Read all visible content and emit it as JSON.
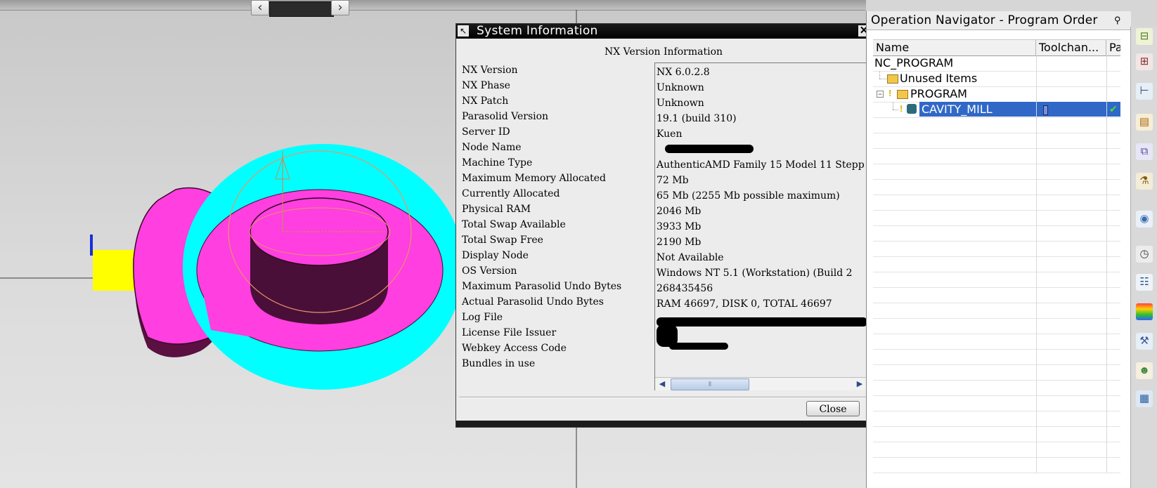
{
  "dialog": {
    "title": "System Information",
    "heading": "NX Version Information",
    "close_label": "Close",
    "rows": [
      {
        "label": "NX Version",
        "value": "NX 6.0.2.8"
      },
      {
        "label": "NX Phase",
        "value": "Unknown"
      },
      {
        "label": "NX Patch",
        "value": "Unknown"
      },
      {
        "label": "Parasolid Version",
        "value": "19.1 (build 310)"
      },
      {
        "label": "Server ID",
        "value": "Kuen"
      },
      {
        "label": "Node Name",
        "value": ""
      },
      {
        "label": "Machine Type",
        "value": "AuthenticAMD Family 15 Model 11 Stepp"
      },
      {
        "label": "Maximum Memory Allocated",
        "value": "72 Mb"
      },
      {
        "label": "Currently Allocated",
        "value": "65 Mb (2255 Mb possible maximum)"
      },
      {
        "label": "Physical RAM",
        "value": "2046 Mb"
      },
      {
        "label": "Total Swap Available",
        "value": "3933 Mb"
      },
      {
        "label": "Total Swap Free",
        "value": "2190 Mb"
      },
      {
        "label": "Display Node",
        "value": "Not Available"
      },
      {
        "label": "OS Version",
        "value": "Windows NT 5.1 (Workstation) (Build 2"
      },
      {
        "label": "Maximum Parasolid Undo Bytes",
        "value": "268435456"
      },
      {
        "label": "Actual Parasolid Undo Bytes",
        "value": "RAM 46697, DISK 0, TOTAL 46697"
      },
      {
        "label": "Log File",
        "value": ""
      },
      {
        "label": "License File Issuer",
        "value": ""
      },
      {
        "label": "Webkey Access Code",
        "value": ""
      },
      {
        "label": "Bundles in use",
        "value": ""
      }
    ]
  },
  "navigator": {
    "title": "Operation Navigator - Program Order",
    "columns": [
      "Name",
      "Toolchan...",
      "Pat"
    ],
    "rows": [
      {
        "name": "NC_PROGRAM"
      },
      {
        "name": "Unused Items"
      },
      {
        "name": "PROGRAM"
      },
      {
        "name": "CAVITY_MILL",
        "selected": true
      }
    ]
  },
  "viewport": {
    "colors": {
      "cavity": "#ff3fdf",
      "ring": "#00ffff",
      "bar": "#ffff00"
    }
  },
  "toolbar": {
    "icons": [
      "program-view-icon",
      "machine-tool-view-icon",
      "geometry-view-icon",
      "method-view-icon",
      "assembly-navigator-icon",
      "part-navigator-icon",
      "reuse-library-icon",
      "history-icon",
      "roles-icon",
      "color-palette-icon",
      "manufacturing-wizard-icon",
      "system-materials-icon",
      "visualization-icon"
    ]
  }
}
